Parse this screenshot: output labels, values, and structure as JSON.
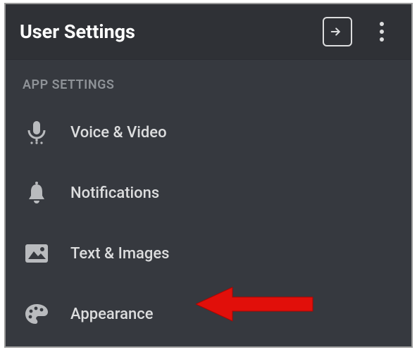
{
  "header": {
    "title": "User Settings"
  },
  "section": {
    "label": "APP SETTINGS"
  },
  "items": [
    {
      "icon": "microphone-icon",
      "label": "Voice & Video"
    },
    {
      "icon": "bell-icon",
      "label": "Notifications"
    },
    {
      "icon": "image-icon",
      "label": "Text & Images"
    },
    {
      "icon": "palette-icon",
      "label": "Appearance"
    }
  ],
  "annotation": {
    "arrow_color": "#e10f0a"
  }
}
